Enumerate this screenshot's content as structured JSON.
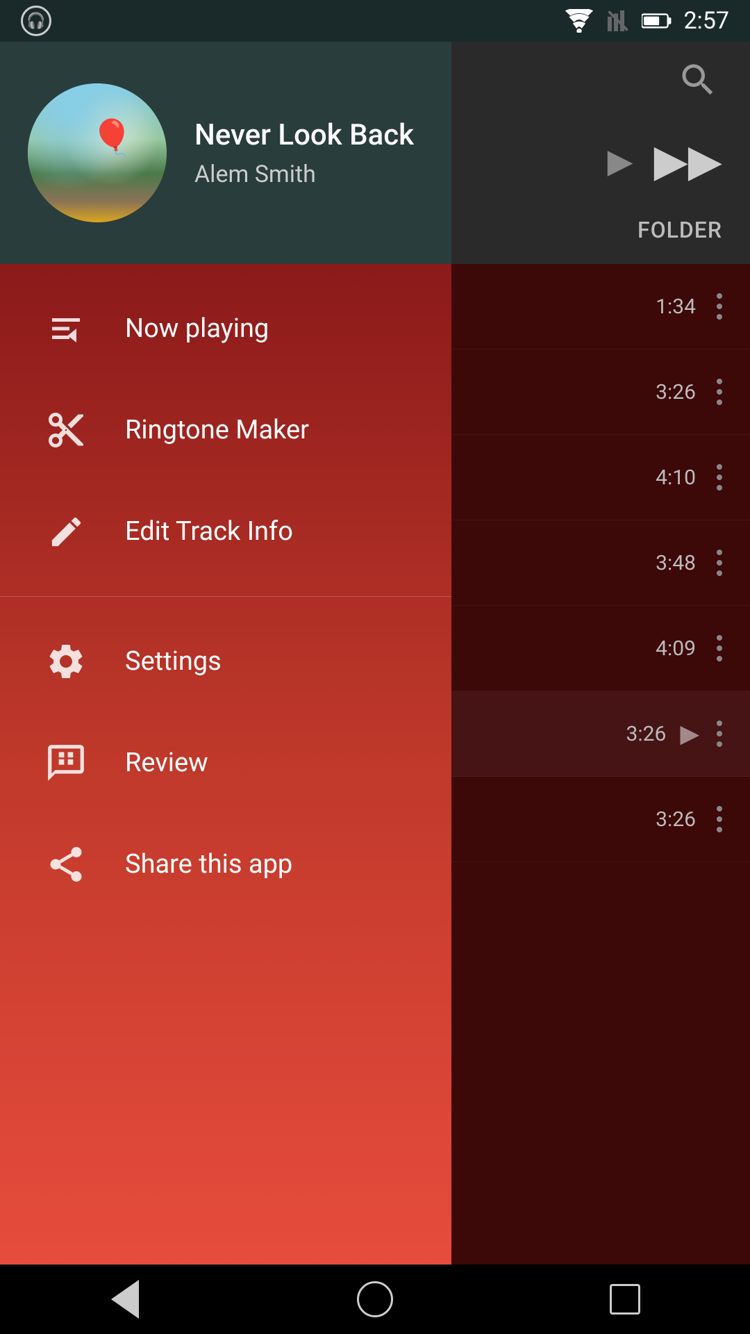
{
  "status_bar": {
    "time": "2:57",
    "icons": [
      "headphone",
      "wifi",
      "signal-blocked",
      "battery"
    ]
  },
  "header": {
    "track_title": "Never Look Back",
    "track_artist": "Alem Smith",
    "folder_label": "FOLDER"
  },
  "menu": {
    "items_top": [
      {
        "id": "now-playing",
        "label": "Now playing",
        "icon": "queue-music"
      },
      {
        "id": "ringtone-maker",
        "label": "Ringtone Maker",
        "icon": "scissors"
      },
      {
        "id": "edit-track-info",
        "label": "Edit Track Info",
        "icon": "pencil"
      }
    ],
    "items_bottom": [
      {
        "id": "settings",
        "label": "Settings",
        "icon": "gear"
      },
      {
        "id": "review",
        "label": "Review",
        "icon": "review"
      },
      {
        "id": "share",
        "label": "Share this app",
        "icon": "share"
      }
    ]
  },
  "track_list": {
    "tracks": [
      {
        "duration": "1:34",
        "has_play": false
      },
      {
        "duration": "3:26",
        "has_play": false
      },
      {
        "duration": "4:10",
        "has_play": false
      },
      {
        "duration": "3:48",
        "has_play": false
      },
      {
        "duration": "4:09",
        "has_play": false
      },
      {
        "duration": "3:26",
        "has_play": true
      },
      {
        "duration": "3:26",
        "has_play": false
      }
    ]
  },
  "nav": {
    "back_label": "back",
    "home_label": "home",
    "recent_label": "recent"
  }
}
